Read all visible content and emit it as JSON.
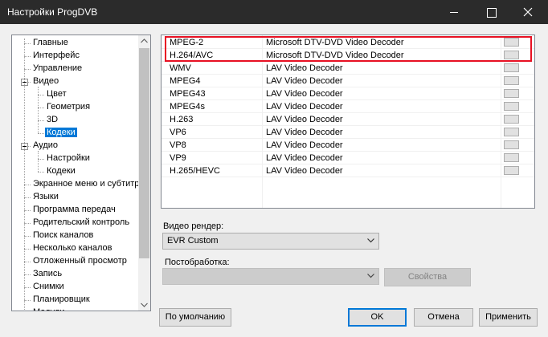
{
  "window": {
    "title": "Настройки ProgDVB"
  },
  "tree": {
    "items": [
      {
        "label": "Главные",
        "level": 0
      },
      {
        "label": "Интерфейс",
        "level": 0
      },
      {
        "label": "Управление",
        "level": 0
      },
      {
        "label": "Видео",
        "level": 0,
        "expandable": true
      },
      {
        "label": "Цвет",
        "level": 1
      },
      {
        "label": "Геометрия",
        "level": 1
      },
      {
        "label": "3D",
        "level": 1
      },
      {
        "label": "Кодеки",
        "level": 1,
        "selected": true
      },
      {
        "label": "Аудио",
        "level": 0,
        "expandable": true
      },
      {
        "label": "Настройки",
        "level": 1
      },
      {
        "label": "Кодеки",
        "level": 1
      },
      {
        "label": "Экранное меню и субтитры",
        "level": 0
      },
      {
        "label": "Языки",
        "level": 0
      },
      {
        "label": "Программа передач",
        "level": 0
      },
      {
        "label": "Родительский контроль",
        "level": 0
      },
      {
        "label": "Поиск каналов",
        "level": 0
      },
      {
        "label": "Несколько каналов",
        "level": 0
      },
      {
        "label": "Отложенный просмотр",
        "level": 0
      },
      {
        "label": "Запись",
        "level": 0
      },
      {
        "label": "Снимки",
        "level": 0
      },
      {
        "label": "Планировщик",
        "level": 0
      },
      {
        "label": "Модули",
        "level": 0
      }
    ]
  },
  "codecs": {
    "rows": [
      {
        "format": "MPEG-2",
        "decoder": "Microsoft DTV-DVD Video Decoder"
      },
      {
        "format": "H.264/AVC",
        "decoder": "Microsoft DTV-DVD Video Decoder"
      },
      {
        "format": "WMV",
        "decoder": "LAV Video Decoder"
      },
      {
        "format": "MPEG4",
        "decoder": "LAV Video Decoder"
      },
      {
        "format": "MPEG43",
        "decoder": "LAV Video Decoder"
      },
      {
        "format": "MPEG4s",
        "decoder": "LAV Video Decoder"
      },
      {
        "format": "H.263",
        "decoder": "LAV Video Decoder"
      },
      {
        "format": "VP6",
        "decoder": "LAV Video Decoder"
      },
      {
        "format": "VP8",
        "decoder": "LAV Video Decoder"
      },
      {
        "format": "VP9",
        "decoder": "LAV Video Decoder"
      },
      {
        "format": "H.265/HEVC",
        "decoder": "LAV Video Decoder"
      }
    ],
    "highlight_color": "#e81123"
  },
  "video_renderer": {
    "label": "Видео рендер:",
    "value": "EVR Custom"
  },
  "postprocessing": {
    "label": "Постобработка:",
    "value": "",
    "properties_label": "Свойства"
  },
  "footer": {
    "defaults_label": "По умолчанию",
    "ok_label": "OK",
    "cancel_label": "Отмена",
    "apply_label": "Применить"
  },
  "colors": {
    "titlebar": "#2b2b2b",
    "selection": "#0078d7",
    "dialog_bg": "#f0f0f0"
  }
}
